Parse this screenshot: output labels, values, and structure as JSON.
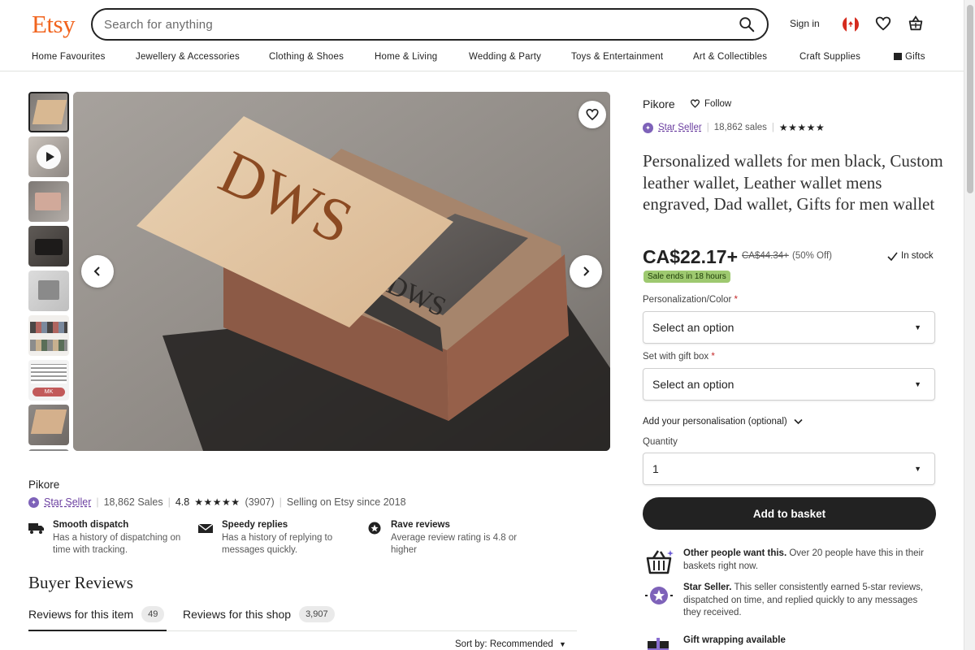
{
  "header": {
    "logo": "Etsy",
    "search_placeholder": "Search for anything",
    "sign_in": "Sign in",
    "icons": [
      "search-icon",
      "canada-flag-icon",
      "heart-icon",
      "basket-icon"
    ]
  },
  "nav": [
    "Home Favourites",
    "Jewellery & Accessories",
    "Clothing & Shoes",
    "Home & Living",
    "Wedding & Party",
    "Toys & Entertainment",
    "Art & Collectibles",
    "Craft Supplies",
    "Gifts"
  ],
  "gallery": {
    "main_image_lid_text": "DWS",
    "main_image_wallet_text": "DWS",
    "thumb_badge": "MK",
    "icons": [
      "play-icon",
      "heart-icon",
      "chevron-left-icon",
      "chevron-right-icon"
    ]
  },
  "shop_info": {
    "name": "Pikore",
    "star_seller": "Star Seller",
    "sales": "18,862 Sales",
    "rating": "4.8",
    "stars": "★★★★★",
    "review_count": "(3907)",
    "since": "Selling on Etsy since 2018",
    "perks": [
      {
        "title": "Smooth dispatch",
        "desc": "Has a history of dispatching on time with tracking."
      },
      {
        "title": "Speedy replies",
        "desc": "Has a history of replying to messages quickly."
      },
      {
        "title": "Rave reviews",
        "desc": "Average review rating is 4.8 or higher"
      }
    ]
  },
  "reviews": {
    "title": "Buyer Reviews",
    "tab_item": "Reviews for this item",
    "tab_item_count": "49",
    "tab_shop": "Reviews for this shop",
    "tab_shop_count": "3,907",
    "sort": "Sort by: Recommended"
  },
  "product": {
    "shop": "Pikore",
    "follow": "Follow",
    "star_seller": "Star Seller",
    "sales": "18,862 sales",
    "stars": "★★★★★",
    "title": "Personalized wallets for men black, Custom leather wallet, Leather wallet mens engraved, Dad wallet, Gifts for men wallet",
    "price": "CA$22.17+",
    "old_price": "CA$44.34+",
    "discount": "(50% Off)",
    "stock": "In stock",
    "sale_notice": "Sale ends in 18 hours",
    "field1_label": "Personalization/Color",
    "field1_value": "Select an option",
    "field2_label": "Set with gift box",
    "field2_value": "Select an option",
    "personalisation": "Add your personalisation (optional)",
    "quantity_label": "Quantity",
    "quantity_value": "1",
    "add_button": "Add to basket",
    "info1_bold": "Other people want this.",
    "info1_text": " Over 20 people have this in their baskets right now.",
    "info2_bold": "Star Seller.",
    "info2_text": " This seller consistently earned 5-star reviews, dispatched on time, and replied quickly to any messages they received.",
    "info3_bold": "Gift wrapping available"
  },
  "colors": {
    "brand": "#f1641e",
    "star_seller": "#6b3fa0",
    "sale": "#9ec970",
    "button": "#222222"
  }
}
